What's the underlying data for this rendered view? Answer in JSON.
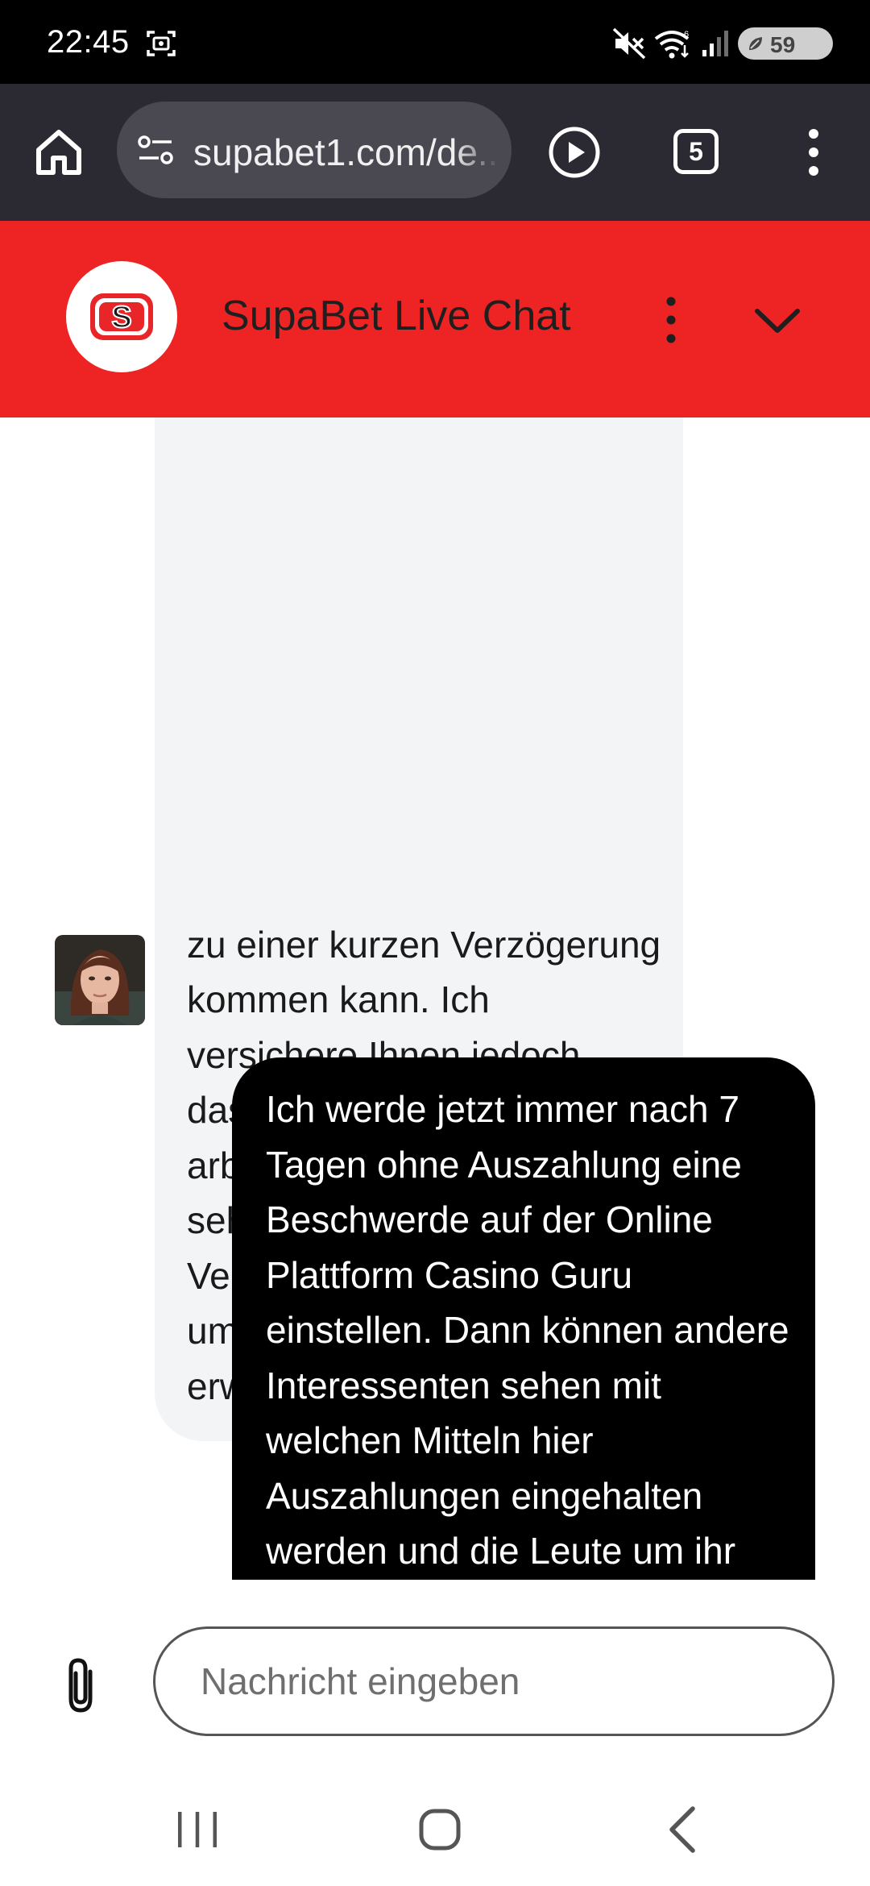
{
  "status_bar": {
    "time": "22:45",
    "battery_level": "59",
    "icons": [
      "screenshot-icon",
      "mute-icon",
      "wifi-icon",
      "signal-icon",
      "battery-icon"
    ]
  },
  "browser": {
    "url": "supabet1.com/de...",
    "tab_count": "5",
    "icons": [
      "home-icon",
      "site-settings-icon",
      "play-icon",
      "tabs-icon",
      "more-vert-icon"
    ]
  },
  "chat": {
    "title": "SupaBet Live Chat",
    "logo_letter": "S",
    "brand_color": "#ee2424",
    "messages": [
      {
        "sender": "agent",
        "text": "zu einer kurzen Verzögerung kommen kann. Ich versichere Ihnen jedoch, dass unser Team aktiv daran arbeitet. Wir danken Ihnen sehr für Ihre Geduld und Ihr Verständnis. Ich bitte Sie nur um noch etwas Geduld, wir erwarten bald Neuigkeiten!"
      },
      {
        "sender": "user",
        "text": "Ich werde jetzt immer nach 7 Tagen ohne Auszahlung eine Beschwerde auf der Online Plattform Casino Guru einstellen. Dann können andere Interessenten sehen mit welchen Mitteln hier Auszahlungen eingehalten werden und die Leute um ihr"
      }
    ]
  },
  "composer": {
    "placeholder": "Nachricht eingeben",
    "value": ""
  },
  "nav": {
    "icons": [
      "recents-icon",
      "home-nav-icon",
      "back-icon"
    ]
  }
}
